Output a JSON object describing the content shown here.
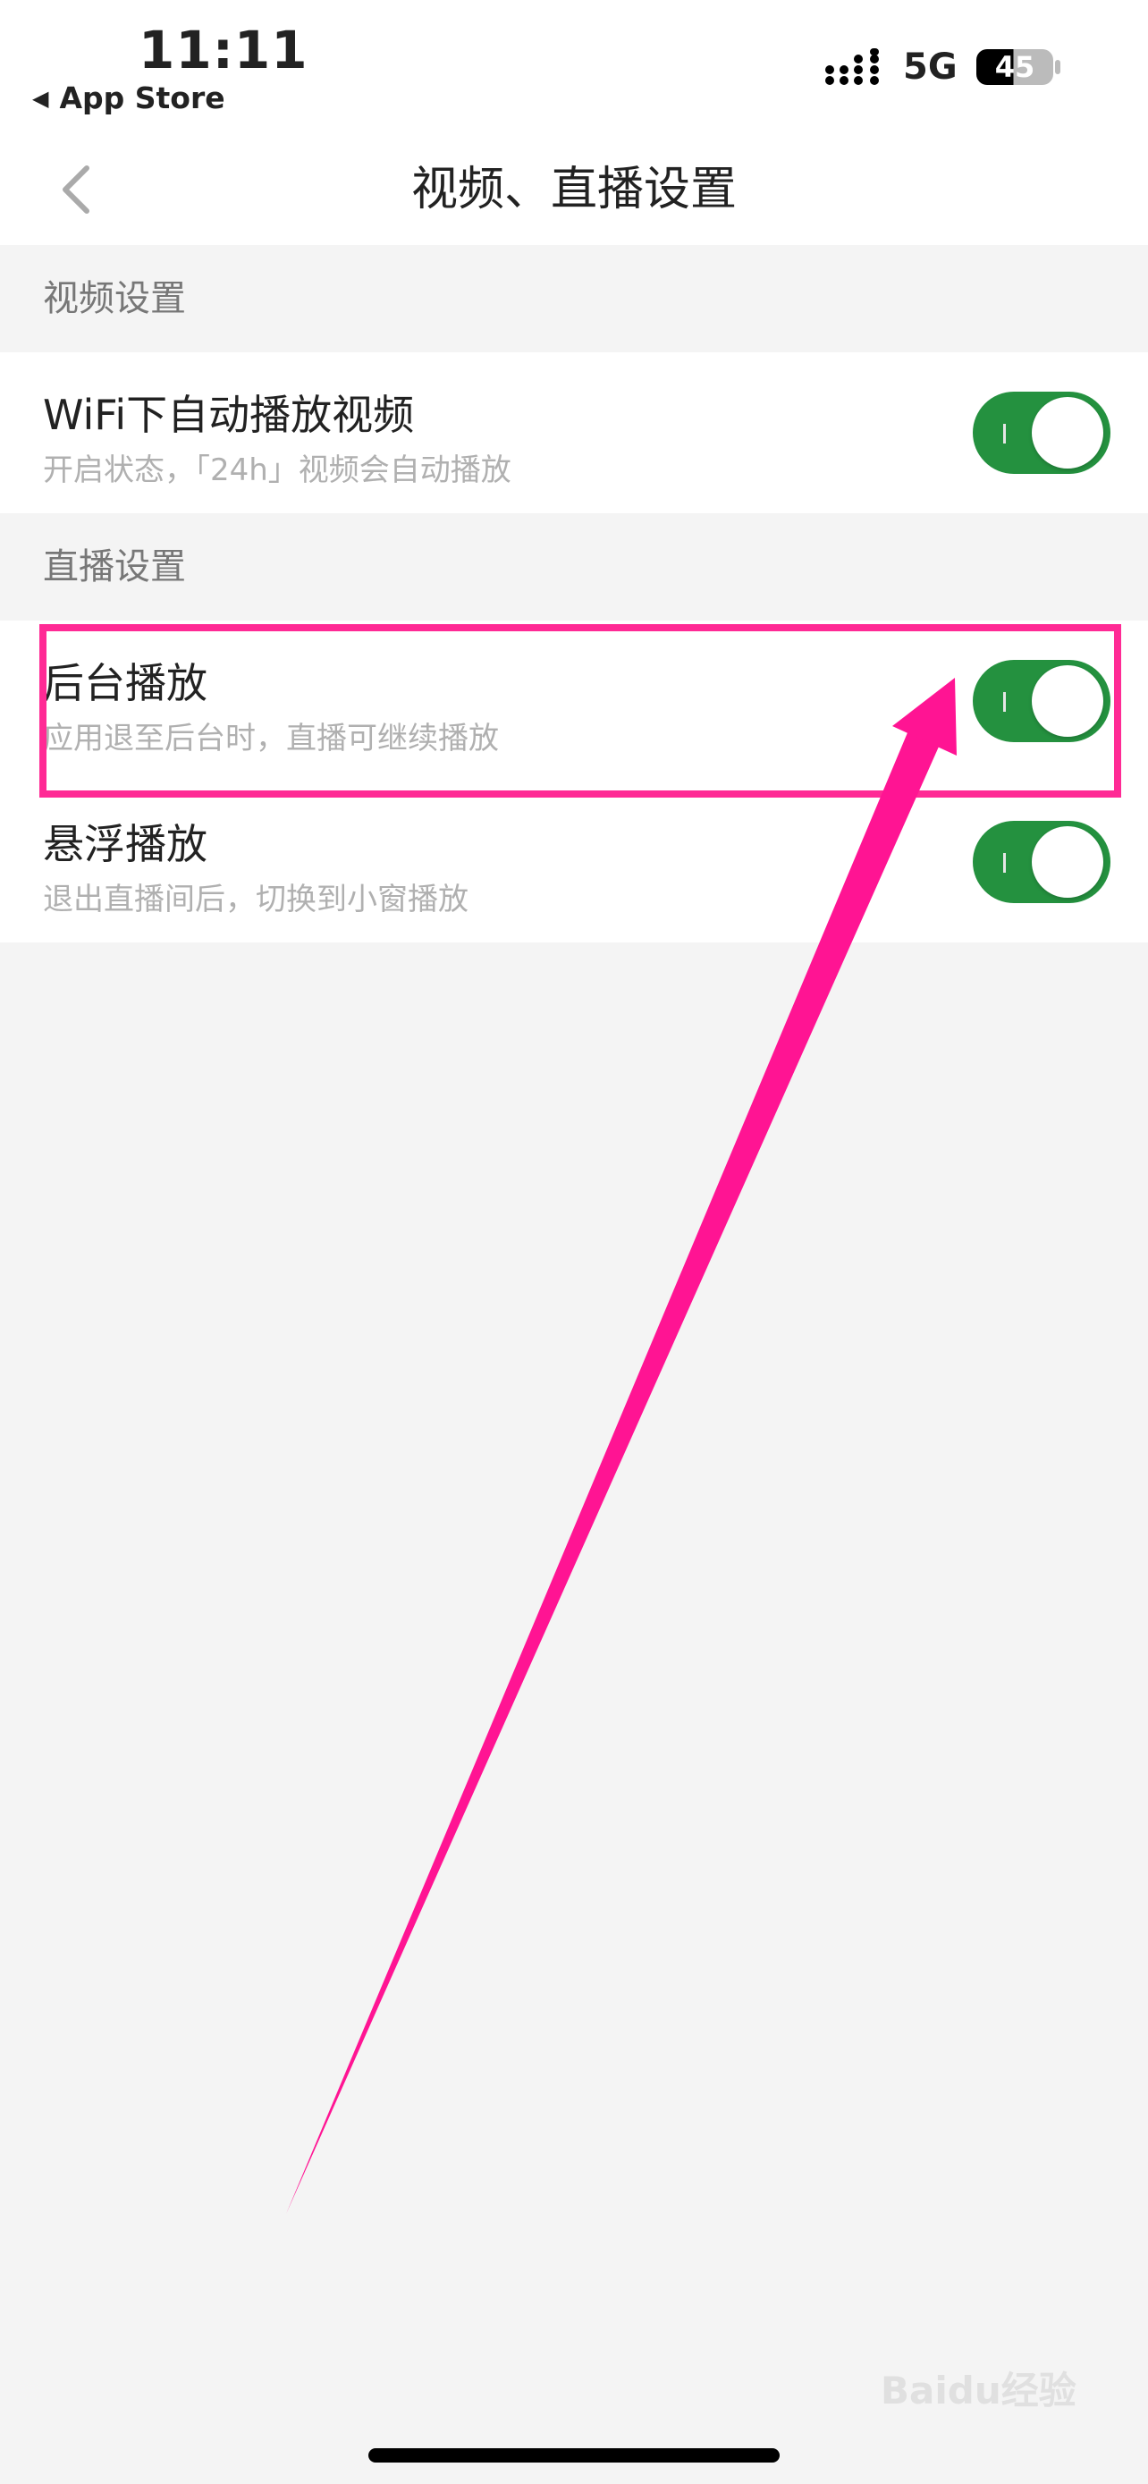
{
  "status_bar": {
    "time": "11:11",
    "back_app": "App Store",
    "network": "5G",
    "battery": "45",
    "icons": {
      "back": "back-triangle-icon",
      "signal": "signal-icon",
      "battery": "battery-icon"
    }
  },
  "nav": {
    "title": "视频、直播设置",
    "back_icon": "chevron-left-icon"
  },
  "sections": [
    {
      "header": "视频设置",
      "rows": [
        {
          "title": "WiFi下自动播放视频",
          "subtitle": "开启状态，「24h」视频会自动播放",
          "enabled": true
        }
      ]
    },
    {
      "header": "直播设置",
      "rows": [
        {
          "title": "后台播放",
          "subtitle": "应用退至后台时，直播可继续播放",
          "enabled": true
        },
        {
          "title": "悬浮播放",
          "subtitle": "退出直播间后，切换到小窗播放",
          "enabled": true
        }
      ]
    }
  ],
  "colors": {
    "toggle_on": "#24913f",
    "annotation": "#ff2a95"
  },
  "watermark": "Baidu经验"
}
